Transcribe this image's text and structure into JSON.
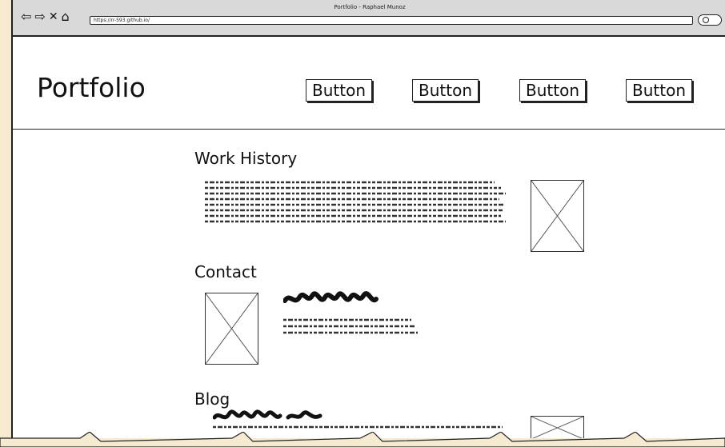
{
  "browser": {
    "window_title": "Portfolio - Raphael Munoz",
    "url": "https://rr-593.github.io/",
    "nav_icons": [
      "back-arrow-icon",
      "forward-arrow-icon",
      "close-icon",
      "home-icon"
    ],
    "search_icon": "search-icon"
  },
  "header": {
    "brand": "Portfolio",
    "buttons": [
      "Button",
      "Button",
      "Button",
      "Button"
    ]
  },
  "sections": {
    "work_history": {
      "title": "Work History"
    },
    "contact": {
      "title": "Contact"
    },
    "blog": {
      "title": "Blog"
    }
  },
  "colors": {
    "outer_background": "#f6ebd0",
    "browser_chrome": "#d9d9d9",
    "ink": "#222222"
  }
}
